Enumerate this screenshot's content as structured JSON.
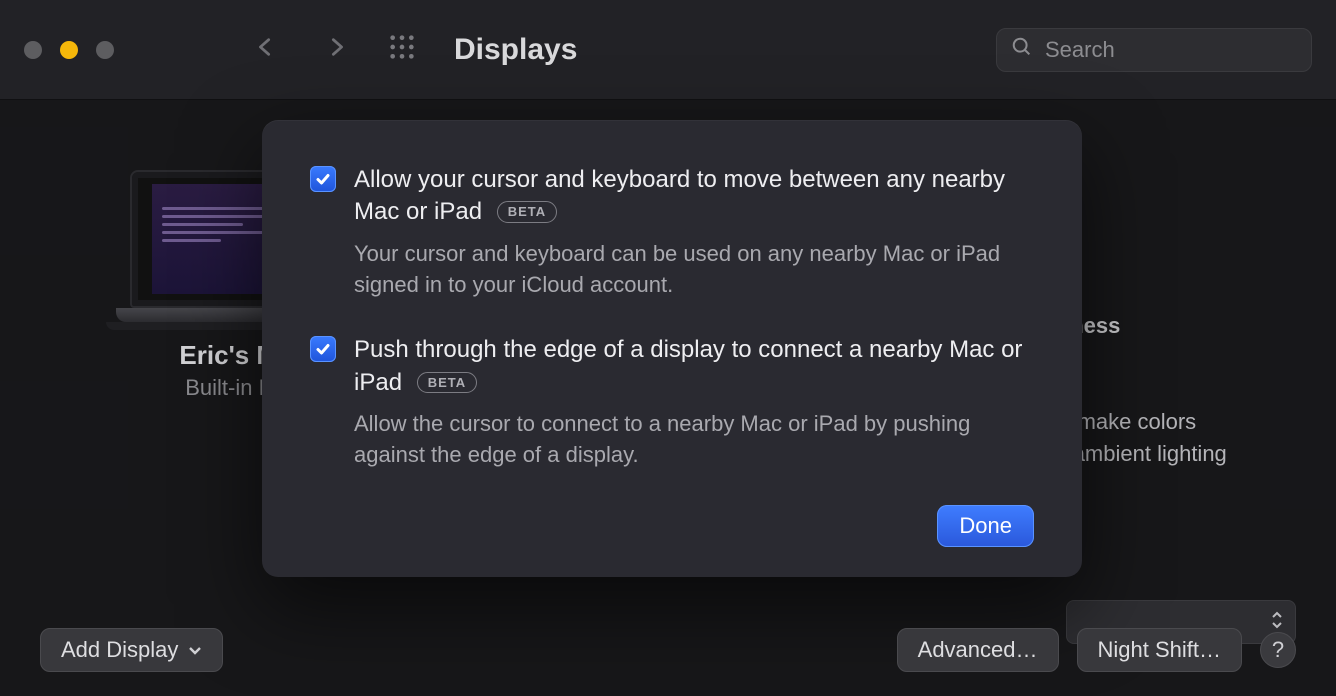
{
  "toolbar": {
    "title": "Displays",
    "search_placeholder": "Search"
  },
  "device": {
    "name": "Eric's Ma",
    "subtitle": "Built-in Re"
  },
  "background": {
    "brightness_fragment": "ghtness",
    "truetone_line1": "y to make colors",
    "truetone_line2": "ent ambient lighting"
  },
  "footer": {
    "add_display": "Add Display",
    "advanced": "Advanced…",
    "night_shift": "Night Shift…",
    "help": "?"
  },
  "sheet": {
    "options": [
      {
        "checked": true,
        "title": "Allow your cursor and keyboard to move between any nearby Mac or iPad",
        "badge": "BETA",
        "description": "Your cursor and keyboard can be used on any nearby Mac or iPad signed in to your iCloud account."
      },
      {
        "checked": true,
        "title": "Push through the edge of a display to connect a nearby Mac or iPad",
        "badge": "BETA",
        "description": "Allow the cursor to connect to a nearby Mac or iPad by pushing against the edge of a display."
      }
    ],
    "done": "Done"
  }
}
